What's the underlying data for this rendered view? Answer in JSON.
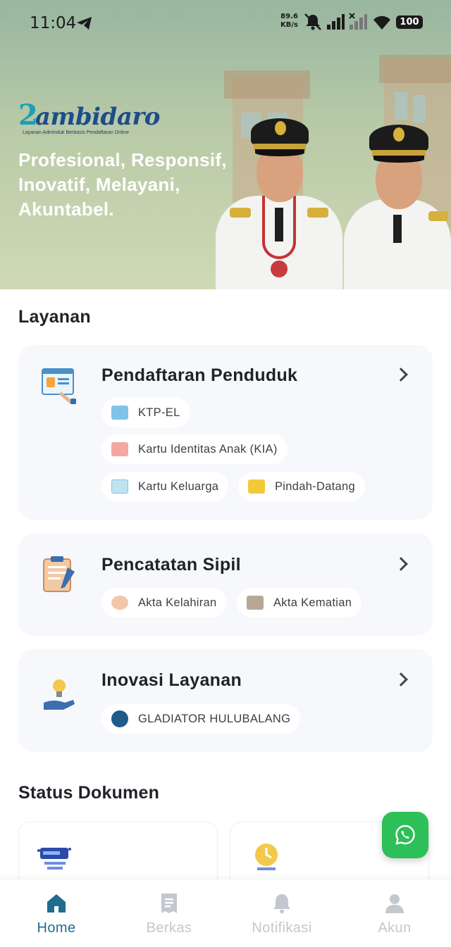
{
  "status_bar": {
    "time": "11:04",
    "net_speed_value": "89.6",
    "net_speed_unit": "KB/s",
    "battery": "100"
  },
  "hero": {
    "logo_text": "ambidaro",
    "logo_subtitle": "Layanan Adminduk Berbasis Pendaftaran Online",
    "tagline": "Profesional, Responsif, Inovatif, Melayani, Akuntabel."
  },
  "layanan": {
    "title": "Layanan",
    "cards": [
      {
        "title": "Pendaftaran Penduduk",
        "icon": "registration-form-icon",
        "chips": [
          {
            "label": "KTP-EL",
            "icon": "id-card-icon"
          },
          {
            "label": "Kartu Identitas Anak (KIA)",
            "icon": "child-id-card-icon"
          },
          {
            "label": "Kartu Keluarga",
            "icon": "family-card-icon"
          },
          {
            "label": "Pindah-Datang",
            "icon": "envelope-icon"
          }
        ]
      },
      {
        "title": "Pencatatan Sipil",
        "icon": "clipboard-icon",
        "chips": [
          {
            "label": "Akta Kelahiran",
            "icon": "baby-icon"
          },
          {
            "label": "Akta Kematian",
            "icon": "grave-icon"
          }
        ]
      },
      {
        "title": "Inovasi Layanan",
        "icon": "idea-hand-icon",
        "chips": [
          {
            "label": "GLADIATOR HULUBALANG",
            "icon": "gladiator-emblem-icon"
          }
        ]
      }
    ]
  },
  "status_dokumen": {
    "title": "Status Dokumen",
    "cards": [
      {
        "icon": "checking-icon"
      },
      {
        "icon": "pending-clock-icon"
      }
    ]
  },
  "fab": {
    "icon": "whatsapp-icon"
  },
  "bottom_nav": [
    {
      "label": "Home",
      "icon": "home-icon",
      "active": true
    },
    {
      "label": "Berkas",
      "icon": "document-icon",
      "active": false
    },
    {
      "label": "Notifikasi",
      "icon": "bell-icon",
      "active": false
    },
    {
      "label": "Akun",
      "icon": "user-icon",
      "active": false
    }
  ],
  "colors": {
    "accent": "#1f6e8f",
    "inactive_nav": "#c3c8cf",
    "card_bg": "#f6f8fc",
    "whatsapp": "#2dbf58"
  }
}
